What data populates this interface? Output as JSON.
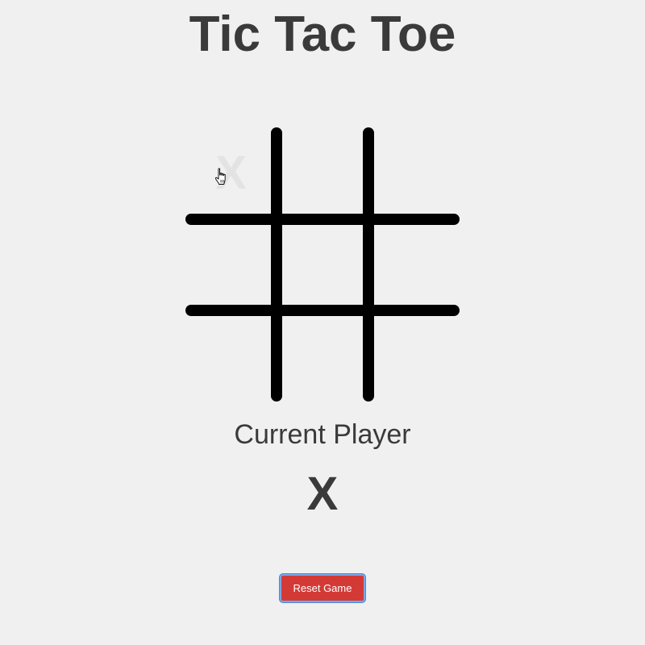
{
  "title": "Tic Tac Toe",
  "board": {
    "cells": [
      "X",
      "",
      "",
      "",
      "",
      "",
      "",
      "",
      ""
    ],
    "hover_preview_cell": 0
  },
  "status": {
    "label": "Current Player",
    "player": "X"
  },
  "controls": {
    "reset_label": "Reset Game"
  },
  "colors": {
    "background": "#f0f0f0",
    "text": "#3a3a3a",
    "grid": "#000000",
    "ghost_mark": "#e3e3e3",
    "reset_button": "#d33a36",
    "focus_ring": "#4d87dc"
  },
  "icons": {
    "cursor": "hand-pointer-icon"
  }
}
